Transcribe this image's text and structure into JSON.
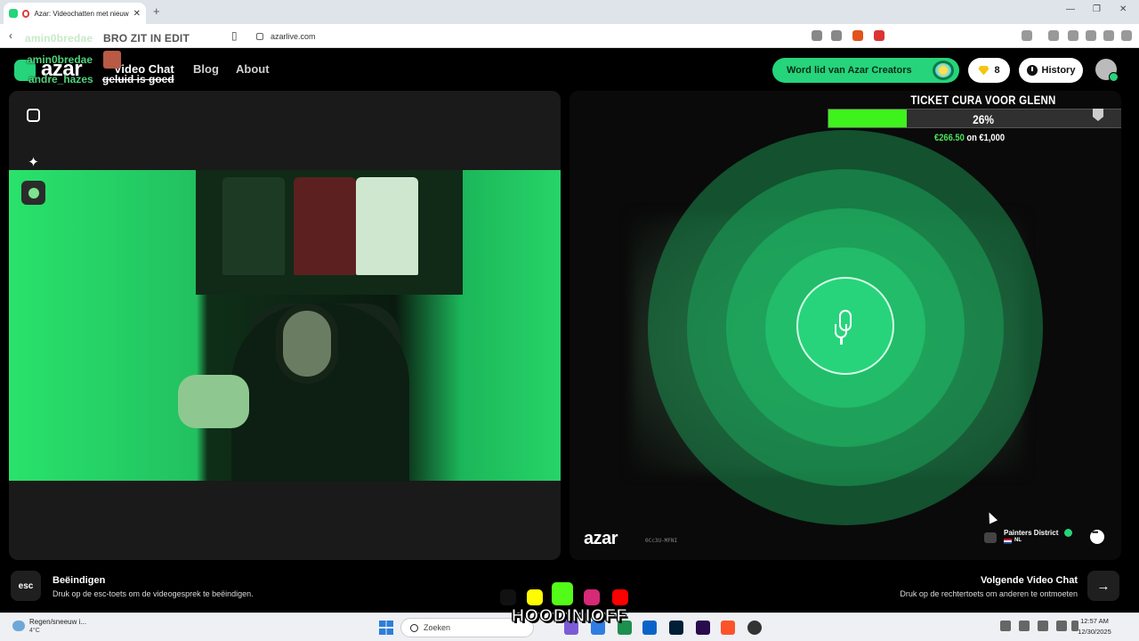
{
  "browser": {
    "tab_title": "Azar: Videochatten met nieuw",
    "url": "azarlive.com",
    "stream_overlay": {
      "top_user": "amin0bredae",
      "top_message": "BRO ZIT IN EDIT"
    }
  },
  "header": {
    "logo": "azar",
    "nav": [
      "Video Chat",
      "Blog",
      "About"
    ],
    "overlay_chat": [
      {
        "user": "amin0bredae",
        "message": ""
      },
      {
        "user": "andre_hazes",
        "message": "geluid is goed"
      }
    ],
    "creators_label": "Word lid van Azar Creators",
    "gems": "8",
    "history_label": "History"
  },
  "remote": {
    "ticket_title": "TICKET CURA VOOR GLENN",
    "ticket_percent_label": "26%",
    "ticket_progress": 0.26,
    "amount_raised": "€266.50",
    "amount_goal": " on €1,000",
    "logo": "azar",
    "session_code": "0Cc3U-MFNI",
    "partner_name": "Painters District",
    "partner_country": "NL"
  },
  "controls": {
    "esc_key": "esc",
    "end_title": "Beëindigen",
    "end_desc": "Druk op de esc-toets om de videogesprek te beëindigen.",
    "next_title": "Volgende Video Chat",
    "next_desc": "Druk op de rechtertoets om anderen te ontmoeten"
  },
  "stream": {
    "streamer": "HOODINIOFF"
  },
  "taskbar": {
    "weather_desc": "Regen/sneeuw i...",
    "weather_temp": "4°C",
    "search_placeholder": "Zoeken",
    "time": "12:57 AM",
    "date": "12/30/2025"
  },
  "colors": {
    "brand_green": "#25d47b",
    "progress_green": "#3ef21c",
    "background": "#000000"
  }
}
